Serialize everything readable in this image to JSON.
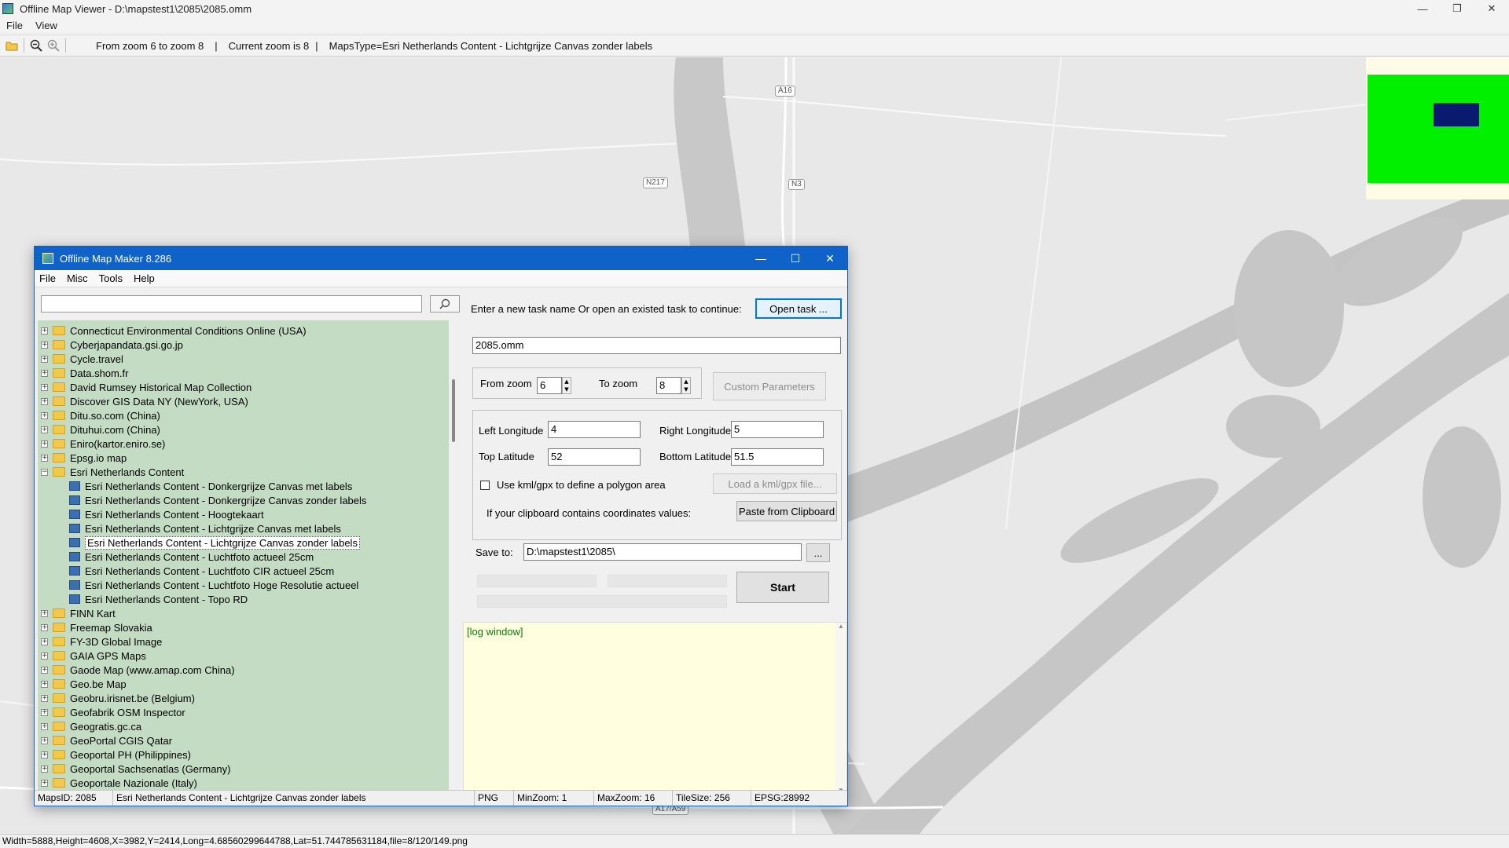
{
  "viewer": {
    "title": "Offline Map Viewer - D:\\mapstest1\\2085\\2085.omm",
    "menus": [
      "File",
      "View"
    ],
    "zoom_range": "From zoom 6 to zoom 8",
    "current_zoom": "Current zoom is 8",
    "maps_type": "MapsType=Esri Netherlands Content - Lichtgrijze Canvas zonder labels",
    "status": "Width=5888,Height=4608,X=3982,Y=2414,Long=4.68560299644788,Lat=51.744785631184,file=8/120/149.png",
    "road_labels": [
      "A16",
      "N217",
      "N3",
      "A17/A59"
    ]
  },
  "dialog": {
    "title": "Offline Map Maker 8.286",
    "menus": [
      "File",
      "Misc",
      "Tools",
      "Help"
    ],
    "search": {
      "value": "",
      "placeholder": ""
    },
    "tree": [
      {
        "label": "Connecticut Environmental Conditions Online (USA)",
        "type": "folder",
        "expanded": false
      },
      {
        "label": "Cyberjapandata.gsi.go.jp",
        "type": "folder",
        "expanded": false
      },
      {
        "label": "Cycle.travel",
        "type": "folder",
        "expanded": false
      },
      {
        "label": "Data.shom.fr",
        "type": "folder",
        "expanded": false
      },
      {
        "label": "David Rumsey Historical Map Collection",
        "type": "folder",
        "expanded": false
      },
      {
        "label": "Discover GIS Data NY (NewYork, USA)",
        "type": "folder",
        "expanded": false
      },
      {
        "label": "Ditu.so.com (China)",
        "type": "folder",
        "expanded": false
      },
      {
        "label": "Dituhui.com (China)",
        "type": "folder",
        "expanded": false
      },
      {
        "label": "Eniro(kartor.eniro.se)",
        "type": "folder",
        "expanded": false
      },
      {
        "label": "Epsg.io map",
        "type": "folder",
        "expanded": false
      },
      {
        "label": "Esri Netherlands Content",
        "type": "folder",
        "expanded": true
      },
      {
        "label": "Esri Netherlands Content - Donkergrijze Canvas met labels",
        "type": "map"
      },
      {
        "label": "Esri Netherlands Content - Donkergrijze Canvas zonder labels",
        "type": "map"
      },
      {
        "label": "Esri Netherlands Content - Hoogtekaart",
        "type": "map"
      },
      {
        "label": "Esri Netherlands Content - Lichtgrijze Canvas met labels",
        "type": "map"
      },
      {
        "label": "Esri Netherlands Content - Lichtgrijze Canvas zonder labels",
        "type": "map",
        "selected": true
      },
      {
        "label": "Esri Netherlands Content - Luchtfoto actueel 25cm",
        "type": "map"
      },
      {
        "label": "Esri Netherlands Content - Luchtfoto CIR actueel 25cm",
        "type": "map"
      },
      {
        "label": "Esri Netherlands Content - Luchtfoto Hoge Resolutie actueel",
        "type": "map"
      },
      {
        "label": "Esri Netherlands Content - Topo RD",
        "type": "map"
      },
      {
        "label": "FINN Kart",
        "type": "folder",
        "expanded": false
      },
      {
        "label": "Freemap Slovakia",
        "type": "folder",
        "expanded": false
      },
      {
        "label": "FY-3D Global Image",
        "type": "folder",
        "expanded": false
      },
      {
        "label": "GAIA GPS Maps",
        "type": "folder",
        "expanded": false
      },
      {
        "label": "Gaode Map (www.amap.com China)",
        "type": "folder",
        "expanded": false
      },
      {
        "label": "Geo.be Map",
        "type": "folder",
        "expanded": false
      },
      {
        "label": "Geobru.irisnet.be (Belgium)",
        "type": "folder",
        "expanded": false
      },
      {
        "label": "Geofabrik OSM Inspector",
        "type": "folder",
        "expanded": false
      },
      {
        "label": "Geogratis.gc.ca",
        "type": "folder",
        "expanded": false
      },
      {
        "label": "GeoPortal CGIS Qatar",
        "type": "folder",
        "expanded": false
      },
      {
        "label": "Geoportal PH (Philippines)",
        "type": "folder",
        "expanded": false
      },
      {
        "label": "Geoportal Sachsenatlas (Germany)",
        "type": "folder",
        "expanded": false
      },
      {
        "label": "Geoportale Nazionale (Italy)",
        "type": "folder",
        "expanded": false
      }
    ],
    "task_prompt": "Enter a new task name Or open an existed task to continue:",
    "open_task_label": "Open task ...",
    "task_name": "2085.omm",
    "from_zoom_label": "From zoom",
    "from_zoom": "6",
    "to_zoom_label": "To zoom",
    "to_zoom": "8",
    "custom_params_label": "Custom Parameters",
    "left_lon_label": "Left Longitude",
    "left_lon": "4",
    "right_lon_label": "Right Longitude",
    "right_lon": "5",
    "top_lat_label": "Top Latitude",
    "top_lat": "52",
    "bottom_lat_label": "Bottom Latitude",
    "bottom_lat": "51.5",
    "kml_checkbox_label": "Use kml/gpx to define a polygon area",
    "kml_checked": false,
    "load_kml_label": "Load a kml/gpx file...",
    "clipboard_prompt": "If your clipboard contains coordinates values:",
    "paste_label": "Paste from Clipboard",
    "save_to_label": "Save to:",
    "save_to": "D:\\mapstest1\\2085\\",
    "browse_label": "...",
    "start_label": "Start",
    "log_label": "[log window]",
    "statusbar": {
      "maps_id": "MapsID: 2085",
      "map_name": "Esri Netherlands Content - Lichtgrijze Canvas zonder labels",
      "format": "PNG",
      "min_zoom": "MinZoom: 1",
      "max_zoom": "MaxZoom: 16",
      "tile_size": "TileSize: 256",
      "epsg": "EPSG:28992"
    }
  },
  "colors": {
    "map_background": "#e8e8e8",
    "water": "#c6c6c6",
    "tree_background": "#c3dcc3",
    "dialog_title": "#0f63c8",
    "log_background": "#ffffe0",
    "overview_green": "#00f000",
    "overview_box": "#0a1a6e"
  }
}
